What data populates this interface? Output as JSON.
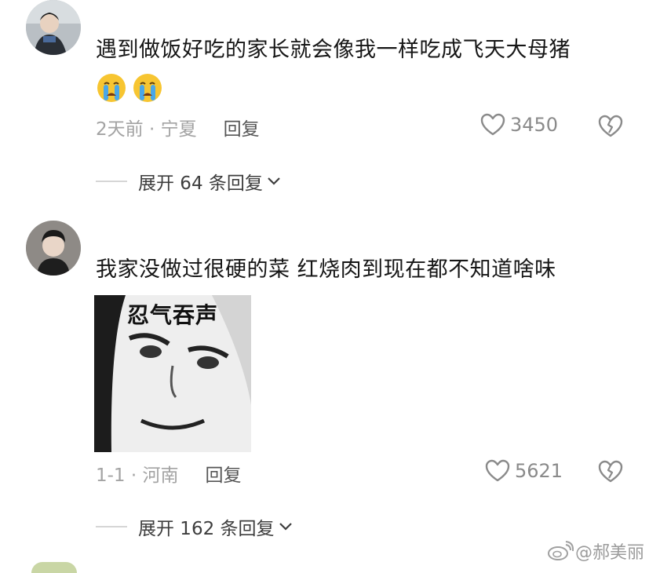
{
  "comments": [
    {
      "text": "遇到做饭好吃的家长就会像我一样吃成飞天大母猪",
      "emojis": [
        "crying-face-icon",
        "crying-face-icon"
      ],
      "time_location": "2天前 · 宁夏",
      "reply_label": "回复",
      "like_count": "3450",
      "expand_label": "展开 64 条回复"
    },
    {
      "text": "我家没做过很硬的菜 红烧肉到现在都不知道啥味",
      "sticker_caption": "忍气吞声",
      "time_location": "1-1 · 河南",
      "reply_label": "回复",
      "like_count": "5621",
      "expand_label": "展开 162 条回复"
    }
  ],
  "watermark": "@郝美丽",
  "colors": {
    "background": "#ffffff",
    "meta_text": "#a3a3a3",
    "icon_gray": "#8a8a8a"
  }
}
